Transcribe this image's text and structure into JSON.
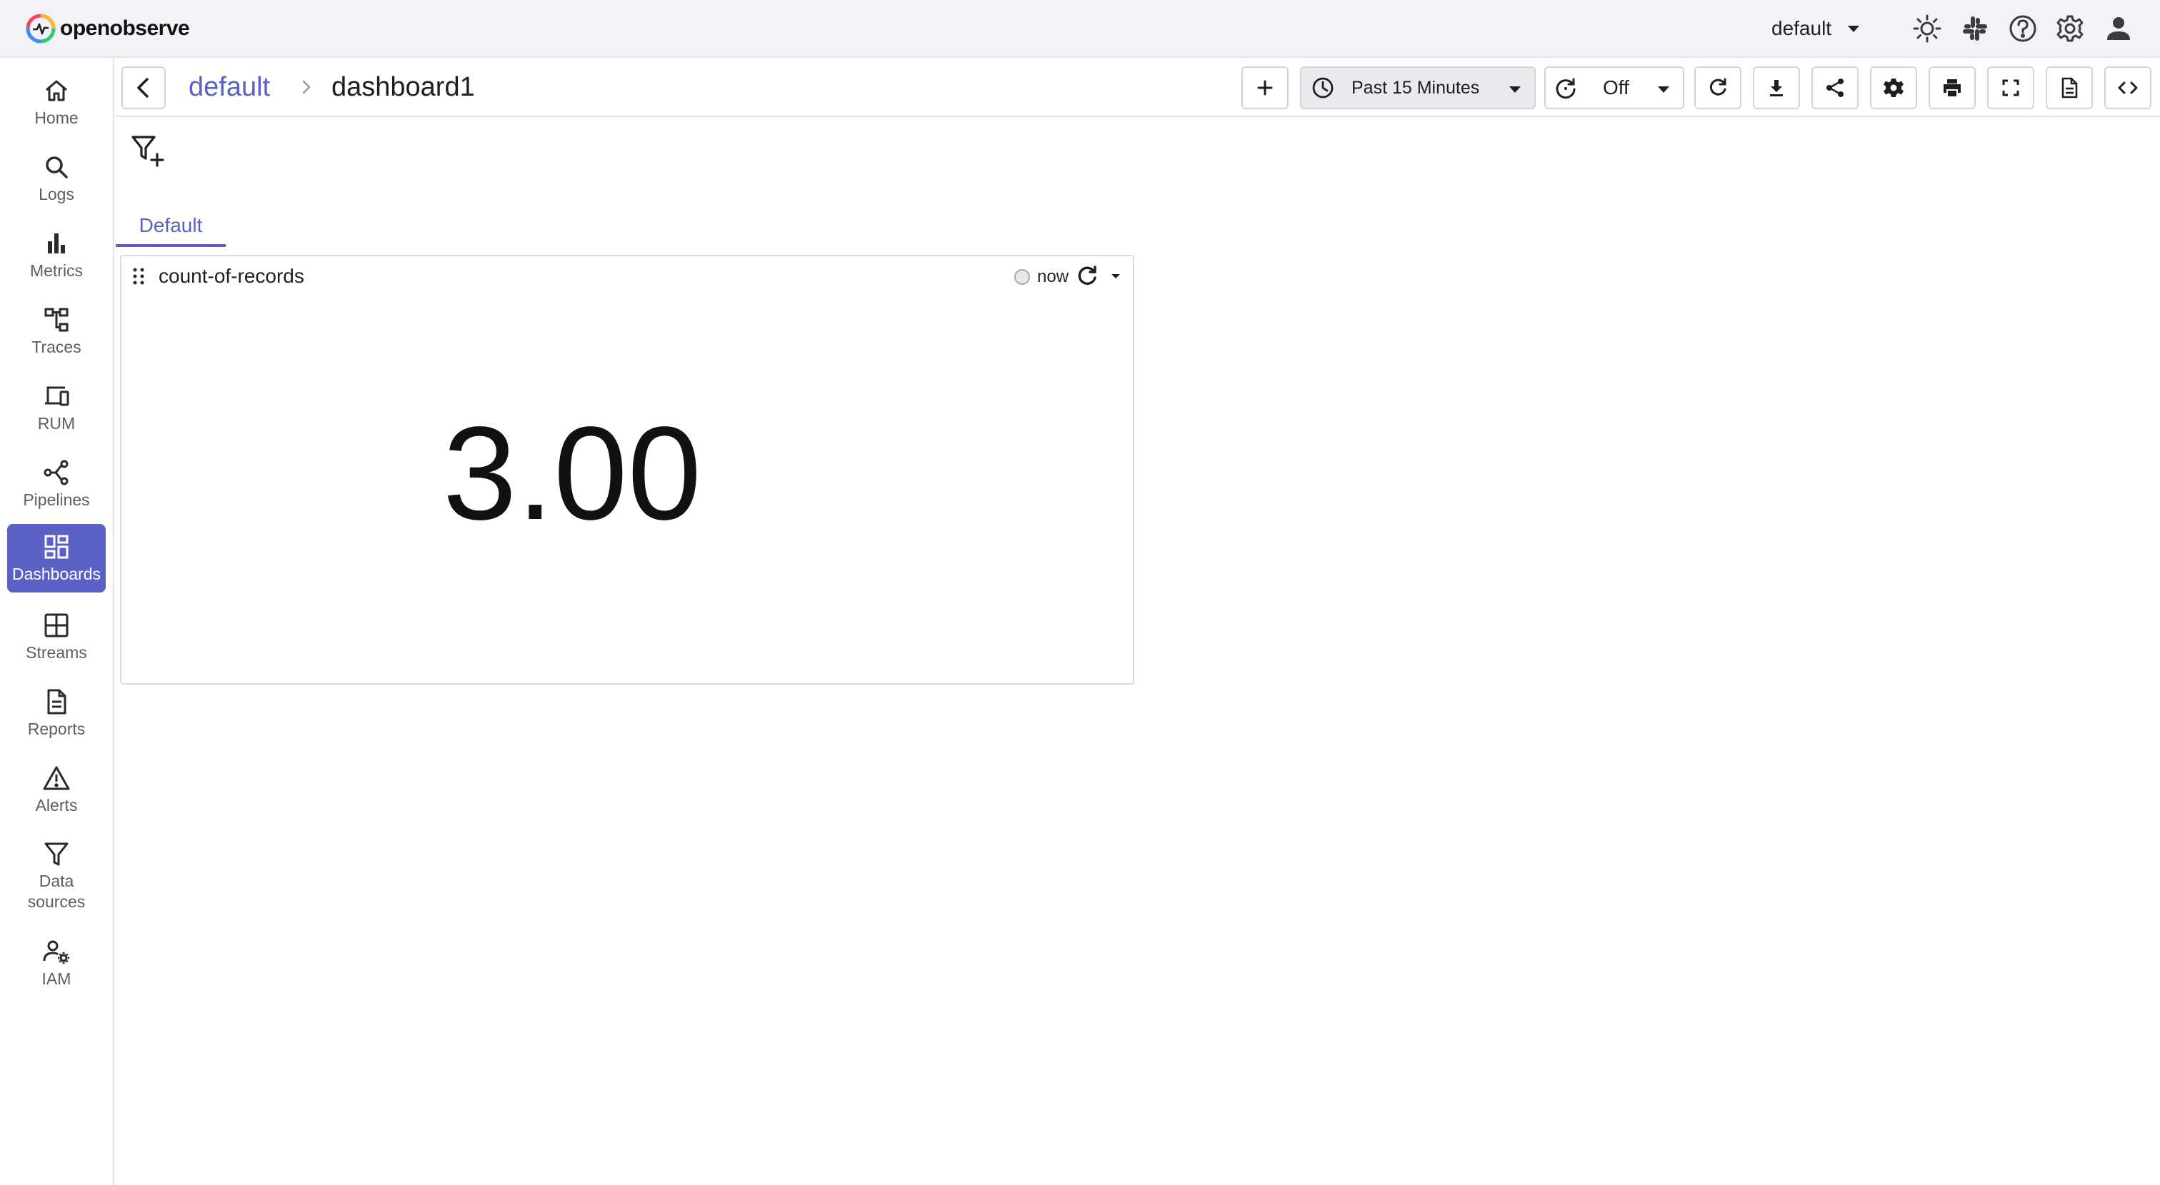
{
  "app": {
    "brand": "openobserve",
    "organization": "default"
  },
  "header": {
    "icons": [
      "theme-toggle-icon",
      "slack-icon",
      "help-icon",
      "settings-icon",
      "user-icon"
    ]
  },
  "sidebar": {
    "items": [
      {
        "label": "Home",
        "icon": "home-icon"
      },
      {
        "label": "Logs",
        "icon": "search-icon"
      },
      {
        "label": "Metrics",
        "icon": "bar-chart-icon"
      },
      {
        "label": "Traces",
        "icon": "tree-icon"
      },
      {
        "label": "RUM",
        "icon": "devices-icon"
      },
      {
        "label": "Pipelines",
        "icon": "pipeline-icon"
      },
      {
        "label": "Dashboards",
        "icon": "dashboard-icon",
        "active": true
      },
      {
        "label": "Streams",
        "icon": "grid-icon"
      },
      {
        "label": "Reports",
        "icon": "document-icon"
      },
      {
        "label": "Alerts",
        "icon": "warning-icon"
      },
      {
        "label": "Data sources",
        "icon": "filter-icon"
      },
      {
        "label": "IAM",
        "icon": "user-gear-icon"
      }
    ]
  },
  "breadcrumb": {
    "folder": "default",
    "dashboard": "dashboard1"
  },
  "toolbar": {
    "time_range": "Past 15 Minutes",
    "refresh_interval": "Off"
  },
  "tabs": [
    "Default"
  ],
  "panel": {
    "title": "count-of-records",
    "last_refreshed": "now",
    "value": "3.00"
  },
  "colors": {
    "accent": "#5b61c4",
    "header_bg": "#f2f2f7"
  }
}
